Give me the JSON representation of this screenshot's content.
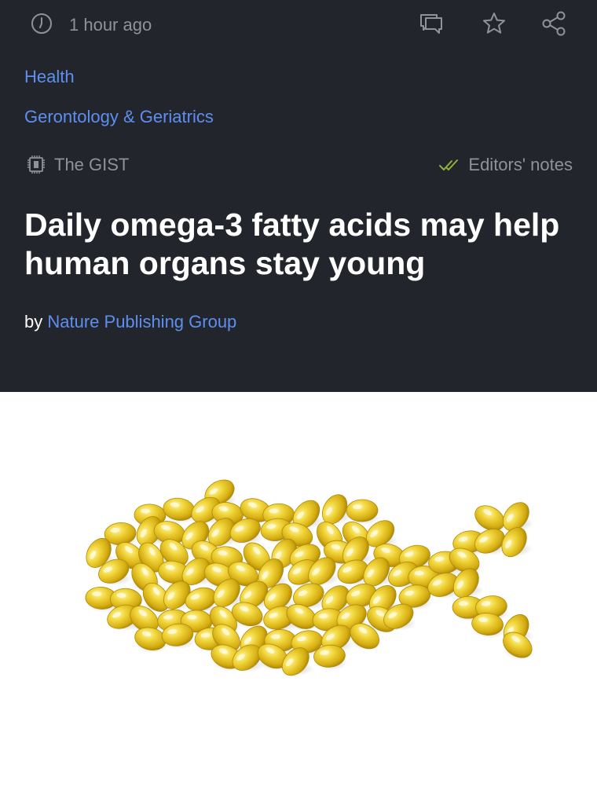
{
  "meta": {
    "time_ago": "1 hour ago",
    "icons": [
      "clock-icon",
      "comment-icon",
      "star-icon",
      "share-icon"
    ]
  },
  "categories": [
    "Health",
    "Gerontology & Geriatrics"
  ],
  "badges": {
    "gist_label": "The GIST",
    "gist_icon": "chip-icon",
    "notes_label": "Editors' notes",
    "notes_icon": "double-check-icon",
    "notes_icon_color": "#8fb33a"
  },
  "article": {
    "title": "Daily omega-3 fatty acids may help human organs stay young",
    "byline_prefix": "by",
    "source": "Nature Publishing Group"
  },
  "image": {
    "subject": "omega-3 capsules arranged in a fish shape"
  },
  "colors": {
    "background": "#22252b",
    "link": "#5e8ff0",
    "muted": "#8e939b",
    "capsule": "#e3c322"
  }
}
